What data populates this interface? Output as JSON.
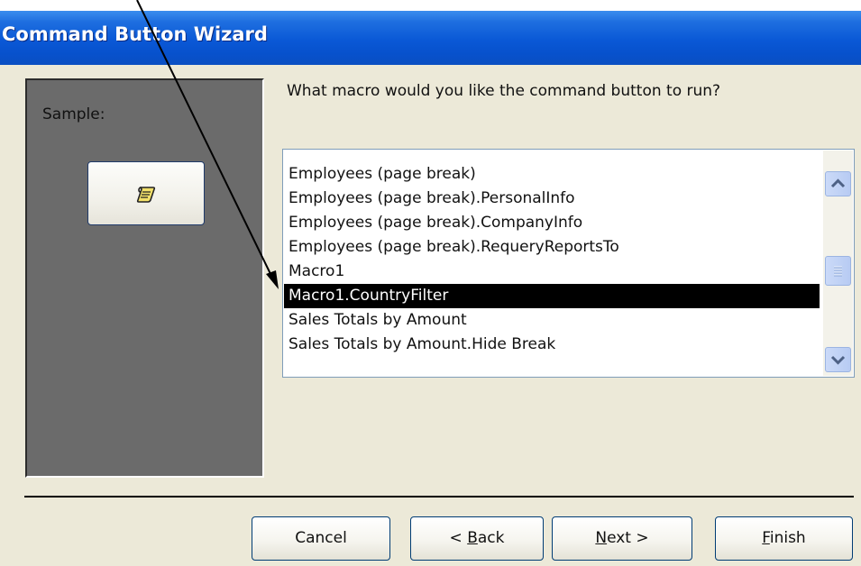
{
  "window": {
    "title": "Command Button Wizard"
  },
  "sample": {
    "label": "Sample:",
    "button_icon": "macro-scroll-icon"
  },
  "prompt": "What macro would you like the command button to run?",
  "macro_list": {
    "items": [
      "Employees (page break)",
      "Employees (page break).PersonalInfo",
      "Employees (page break).CompanyInfo",
      "Employees (page break).RequeryReportsTo",
      "Macro1",
      "Macro1.CountryFilter",
      "Sales Totals by Amount",
      "Sales Totals by Amount.Hide Break"
    ],
    "selected": "Macro1.CountryFilter"
  },
  "buttons": {
    "cancel": "Cancel",
    "back_prefix": "< ",
    "back_key": "B",
    "back_rest": "ack",
    "next_key": "N",
    "next_rest": "ext >",
    "finish_key": "F",
    "finish_rest": "inish"
  },
  "colors": {
    "titlebar": "#0a58d6",
    "dialog_bg": "#ece9d8",
    "sample_panel": "#6b6b6b",
    "selection": "#000000"
  }
}
